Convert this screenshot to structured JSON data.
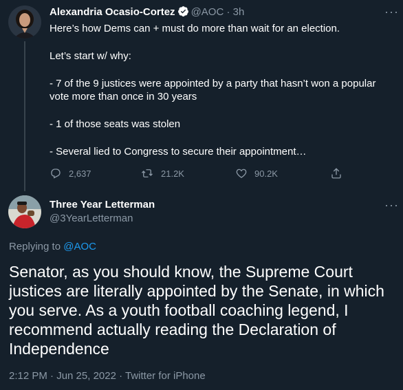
{
  "original_tweet": {
    "display_name": "Alexandria Ocasio-Cortez",
    "handle": "@AOC",
    "separator": "·",
    "time_ago": "3h",
    "lines": [
      "Here’s how Dems can + must do more than wait for an election.",
      "Let’s start w/ why:",
      "- 7 of the 9 justices were appointed by a party that hasn’t won a popular",
      "vote more than once in 30 years",
      "- 1 of those seats was stolen",
      "- Several lied to Congress to secure their appointment…"
    ],
    "replies_count": "2,637",
    "retweets_count": "21.2K",
    "likes_count": "90.2K",
    "verified_icon": "verified-badge-icon",
    "accent_color": "#1d9bf0"
  },
  "reply_tweet": {
    "display_name": "Three Year Letterman",
    "handle": "@3YearLetterman",
    "replying_to_prefix": "Replying to ",
    "replying_to_handle": "@AOC",
    "body": "Senator, as you should know, the Supreme Court justices are literally appointed by the Senate, in which you serve. As a youth football coaching legend, I recommend actually reading the Declaration of Independence",
    "timestamp": "2:12 PM · Jun 25, 2022 · Twitter for iPhone"
  },
  "more_label": "···",
  "colors": {
    "background": "#15202b",
    "muted_text": "#8b98a5",
    "link": "#1d9bf0",
    "thread_line": "#38444d"
  }
}
